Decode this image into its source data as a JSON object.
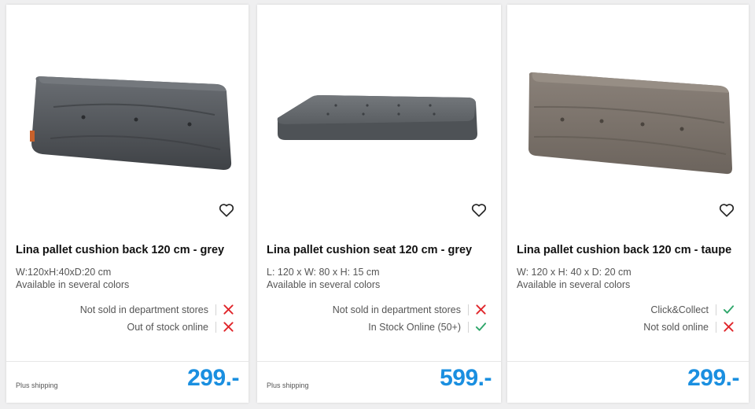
{
  "colors": {
    "price": "#1a8fe0",
    "check": "#2ea66a",
    "cross": "#e0262b",
    "grey_cushion": "#55595e",
    "taupe_cushion": "#7d746c"
  },
  "products": [
    {
      "title": "Lina pallet cushion back 120 cm - grey",
      "dimensions": "W:120xH:40xD:20 cm",
      "colors_note": "Available in several colors",
      "availability": [
        {
          "label": "Not sold in department stores",
          "status_icon": "cross-icon"
        },
        {
          "label": "Out of stock online",
          "status_icon": "cross-icon"
        }
      ],
      "shipping": "Plus shipping",
      "price": "299.-",
      "image_icon": "grey-back-cushion-image",
      "wishlist_icon": "heart-icon"
    },
    {
      "title": "Lina pallet cushion seat 120 cm - grey",
      "dimensions": "L: 120 x W: 80 x H: 15 cm",
      "colors_note": "Available in several colors",
      "availability": [
        {
          "label": "Not sold in department stores",
          "status_icon": "cross-icon"
        },
        {
          "label": "In Stock Online (50+)",
          "status_icon": "check-icon"
        }
      ],
      "shipping": "Plus shipping",
      "price": "599.-",
      "image_icon": "grey-seat-cushion-image",
      "wishlist_icon": "heart-icon"
    },
    {
      "title": "Lina pallet cushion back 120 cm - taupe",
      "dimensions": "W: 120 x H: 40 x D: 20 cm",
      "colors_note": "Available in several colors",
      "availability": [
        {
          "label": "Click&Collect",
          "status_icon": "check-icon"
        },
        {
          "label": "Not sold online",
          "status_icon": "cross-icon"
        }
      ],
      "shipping": "",
      "price": "299.-",
      "image_icon": "taupe-back-cushion-image",
      "wishlist_icon": "heart-icon"
    }
  ]
}
